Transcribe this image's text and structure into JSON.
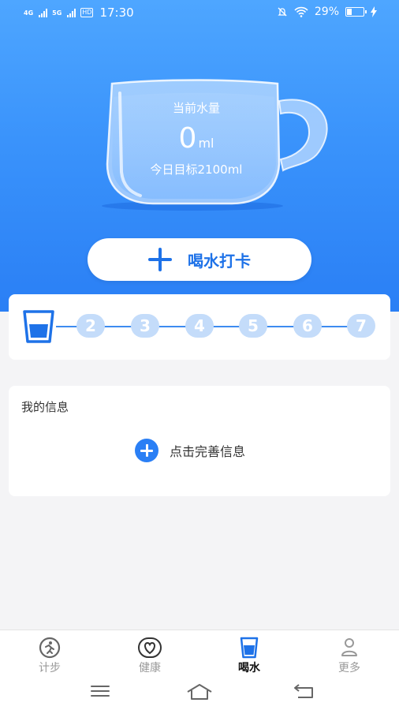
{
  "status_bar": {
    "network_1": "4G",
    "network_2": "5G",
    "hd_badge": "HD",
    "time": "17:30",
    "battery": "29%"
  },
  "cup": {
    "label": "当前水量",
    "amount": "0",
    "unit": "ml",
    "target": "今日目标2100ml"
  },
  "checkin_button": {
    "label": "喝水打卡"
  },
  "progress": {
    "steps": [
      "2",
      "3",
      "4",
      "5",
      "6",
      "7"
    ]
  },
  "my_info": {
    "title": "我的信息",
    "complete_prompt": "点击完善信息"
  },
  "tabs": [
    {
      "label": "计步",
      "icon": "running-person-icon",
      "active": false
    },
    {
      "label": "健康",
      "icon": "heart-icon",
      "active": false
    },
    {
      "label": "喝水",
      "icon": "water-cup-icon",
      "active": true
    },
    {
      "label": "更多",
      "icon": "user-icon",
      "active": false
    }
  ],
  "colors": {
    "accent": "#2a7ff5",
    "hero_top": "#4ea6ff",
    "step_inactive": "#c4dcfa"
  }
}
